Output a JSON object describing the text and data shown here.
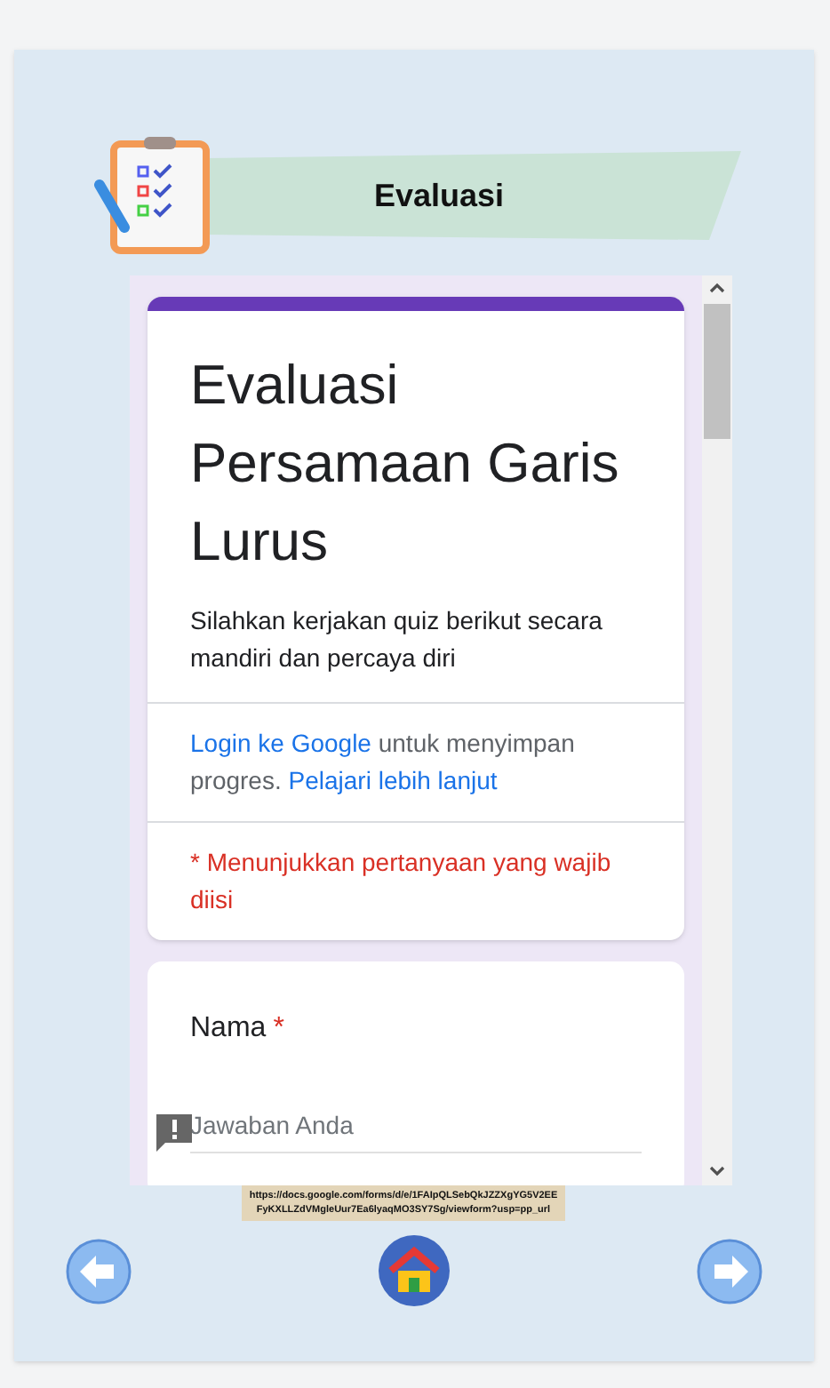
{
  "header": {
    "title": "Evaluasi"
  },
  "form": {
    "title": "Evaluasi Persamaan Garis Lurus",
    "description": "Silahkan kerjakan quiz berikut secara mandiri dan percaya diri",
    "login_link": "Login ke Google",
    "login_text": "untuk menyimpan progres.",
    "learn_link": "Pelajari lebih lanjut",
    "required_note": "* Menunjukkan pertanyaan yang wajib diisi",
    "questions": [
      {
        "label": "Nama",
        "required_mark": "*",
        "placeholder": "Jawaban Anda"
      }
    ]
  },
  "url": "https://docs.google.com/forms/d/e/1FAIpQLSebQkJZZXgYG5V2EEFyKXLLZdVMgleUur7Ea6lyaqMO3SY7Sg/viewform?usp=pp_url"
}
